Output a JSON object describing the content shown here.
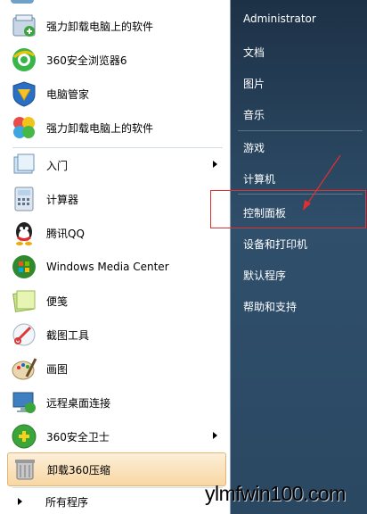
{
  "left_panel": {
    "items": [
      {
        "label": "强力卸载电脑上的软件",
        "icon": "uninstall-box-icon"
      },
      {
        "label": "360安全浏览器6",
        "icon": "360-browser-icon"
      },
      {
        "label": "电脑管家",
        "icon": "pc-manager-shield-icon"
      },
      {
        "label": "强力卸载电脑上的软件",
        "icon": "uninstall-clover-icon"
      },
      {
        "label": "入门",
        "icon": "getting-started-icon"
      },
      {
        "label": "计算器",
        "icon": "calculator-icon"
      },
      {
        "label": "腾讯QQ",
        "icon": "qq-penguin-icon"
      },
      {
        "label": "Windows Media Center",
        "icon": "windows-media-center-icon"
      },
      {
        "label": "便笺",
        "icon": "sticky-notes-icon"
      },
      {
        "label": "截图工具",
        "icon": "snipping-tool-icon"
      },
      {
        "label": "画图",
        "icon": "paint-palette-icon"
      },
      {
        "label": "远程桌面连接",
        "icon": "remote-desktop-icon"
      },
      {
        "label": "360安全卫士",
        "icon": "360-guard-icon"
      },
      {
        "label": "卸载360压缩",
        "icon": "uninstall-360zip-icon"
      }
    ],
    "all_programs": "所有程序"
  },
  "right_panel": {
    "items": [
      "Administrator",
      "文档",
      "图片",
      "音乐",
      "游戏",
      "计算机",
      "控制面板",
      "设备和打印机",
      "默认程序",
      "帮助和支持"
    ]
  },
  "watermark": "ylmfwin100.com",
  "colors": {
    "annotation_red": "#e03030",
    "highlight": "#f8d7a3"
  }
}
